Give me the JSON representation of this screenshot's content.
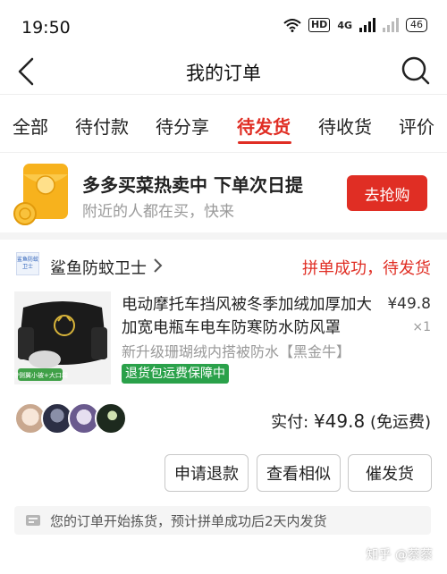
{
  "status_bar": {
    "time": "19:50",
    "hd": "HD",
    "network": "4G",
    "battery": "46"
  },
  "nav": {
    "title": "我的订单"
  },
  "tabs": [
    {
      "label": "全部",
      "active": false
    },
    {
      "label": "待付款",
      "active": false
    },
    {
      "label": "待分享",
      "active": false
    },
    {
      "label": "待发货",
      "active": true
    },
    {
      "label": "待收货",
      "active": false
    },
    {
      "label": "评价",
      "active": false
    }
  ],
  "promo": {
    "title": "多多买菜热卖中 下单次日提",
    "subtitle": "附近的人都在买，快来",
    "button": "去抢购"
  },
  "order": {
    "shop_logo_text": "鲨鱼防蚊卫士",
    "shop_name": "鲨鱼防蚊卫士",
    "status": "拼单成功，待发货",
    "product_title": "电动摩托车挡风被冬季加绒加厚加大加宽电瓶车电车防寒防水防风罩",
    "price": "¥49.8",
    "quantity": "×1",
    "sku": "新升级珊瑚绒内搭被防水【黑金牛】",
    "guarantee": "退货包运费保障中",
    "image_caption": "带侧翼小被+大口袋",
    "paid_label": "实付: ",
    "paid_amount": "¥49.8",
    "paid_note": " (免运费)",
    "buttons": {
      "refund": "申请退款",
      "similar": "查看相似",
      "urge": "催发货"
    },
    "notice": "您的订单开始拣货，预计拼单成功后2天内发货"
  },
  "watermark": "知乎 @蔡蔡",
  "colors": {
    "accent": "#e02e24",
    "green": "#2aa14a",
    "muted": "#9a9a9a"
  }
}
